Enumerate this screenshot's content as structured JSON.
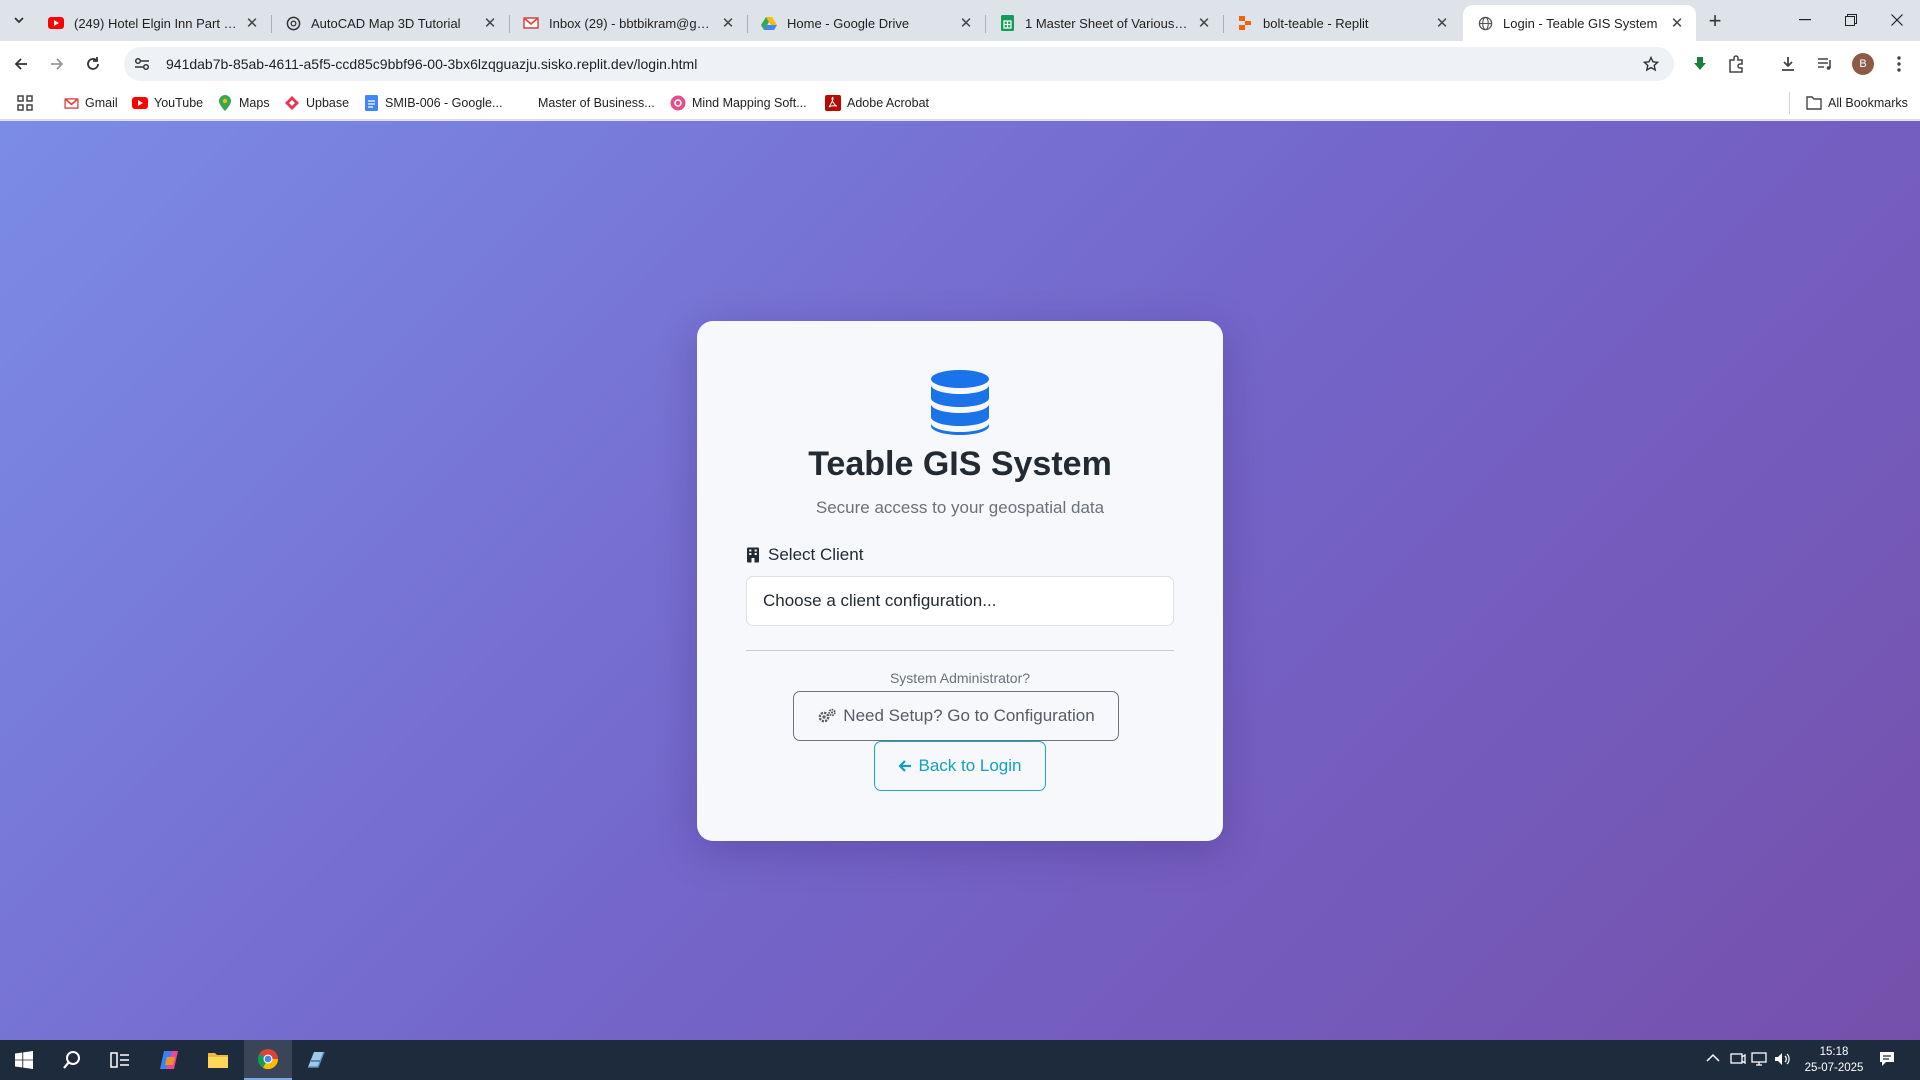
{
  "browser": {
    "tabs": [
      {
        "title": "(249) Hotel Elgin Inn Part 1 | Full",
        "icon": "youtube-icon"
      },
      {
        "title": "AutoCAD Map 3D Tutorial",
        "icon": "openai-icon"
      },
      {
        "title": "Inbox (29) - bbtbikram@gmail.com",
        "icon": "gmail-icon"
      },
      {
        "title": "Home - Google Drive",
        "icon": "drive-icon"
      },
      {
        "title": "1 Master Sheet of Various Jobs",
        "icon": "sheets-icon"
      },
      {
        "title": "bolt-teable - Replit",
        "icon": "replit-icon"
      },
      {
        "title": "Login - Teable GIS System",
        "icon": "globe-icon"
      }
    ],
    "url": "941dab7b-85ab-4611-a5f5-ccd85c9bbf96-00-3bx6lzqguazju.sisko.replit.dev/login.html",
    "profile_initial": "B",
    "bookmarks": [
      {
        "label": "Gmail",
        "icon": "gmail-icon"
      },
      {
        "label": "YouTube",
        "icon": "youtube-icon"
      },
      {
        "label": "Maps",
        "icon": "maps-icon"
      },
      {
        "label": "Upbase",
        "icon": "upbase-icon"
      },
      {
        "label": "SMIB-006 - Google...",
        "icon": "docs-icon"
      },
      {
        "label": "Master of Business...",
        "icon": "none"
      },
      {
        "label": "Mind Mapping Soft...",
        "icon": "mindmap-icon"
      },
      {
        "label": "Adobe Acrobat",
        "icon": "acrobat-icon"
      }
    ],
    "all_bookmarks": "All Bookmarks"
  },
  "login": {
    "icon": "database-icon",
    "title": "Teable GIS System",
    "subtitle": "Secure access to your geospatial data",
    "select_label": "Select Client",
    "select_placeholder": "Choose a client configuration...",
    "admin_question": "System Administrator?",
    "config_button": "Need Setup? Go to Configuration",
    "back_button": "Back to Login"
  },
  "colors": {
    "gradient_start": "#7b8ce6",
    "gradient_end": "#7550ab",
    "primary_blue": "#1a73e8",
    "info": "#13a0c4"
  },
  "taskbar": {
    "time": "15:18",
    "date": "25-07-2025"
  }
}
